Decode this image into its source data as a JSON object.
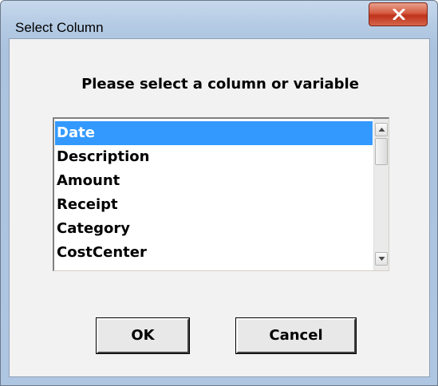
{
  "window": {
    "title": "Select Column"
  },
  "dialog": {
    "prompt": "Please select a column or variable",
    "list": {
      "items": [
        "Date",
        "Description",
        "Amount",
        "Receipt",
        "Category",
        "CostCenter"
      ],
      "selected_index": 0
    },
    "buttons": {
      "ok_label": "OK",
      "cancel_label": "Cancel"
    }
  },
  "icons": {
    "close": "close-icon",
    "scroll_up": "arrow-up-icon",
    "scroll_down": "arrow-down-icon"
  },
  "colors": {
    "selection": "#3399ff",
    "close_button": "#c7432b",
    "dialog_bg": "#f2f2f2",
    "frame": "#b5cbe4"
  }
}
